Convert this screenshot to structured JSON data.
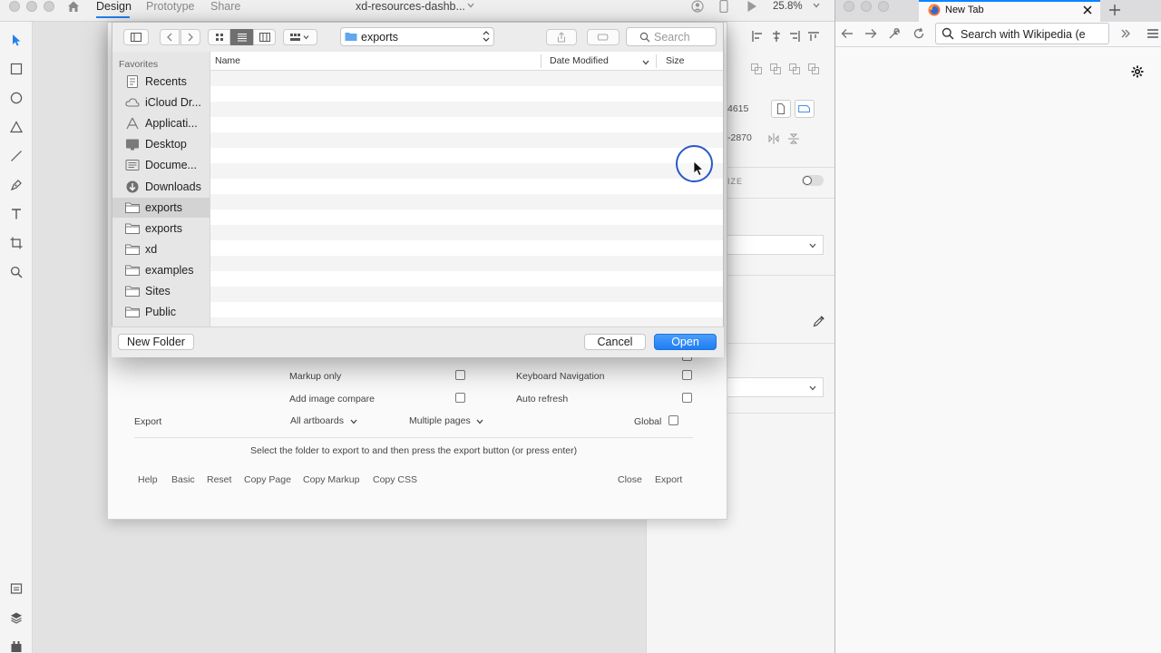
{
  "xd": {
    "tabs": {
      "design": "Design",
      "prototype": "Prototype",
      "share": "Share"
    },
    "document_title": "xd-resources-dashb...",
    "zoom_level": "25.8%",
    "props": {
      "x_value": "4615",
      "y_value": "-2870",
      "fragment": "IZE"
    }
  },
  "plugin": {
    "markup_only": "Markup only",
    "add_image_compare": "Add image compare",
    "keyboard_navigation": "Keyboard Navigation",
    "auto_refresh": "Auto refresh",
    "export_label": "Export",
    "all_artboards": "All artboards",
    "multiple_pages": "Multiple pages",
    "global": "Global",
    "hint": "Select the folder to export to and then press the export button (or press enter)",
    "links": {
      "help": "Help",
      "basic": "Basic",
      "reset": "Reset",
      "copy_page": "Copy Page",
      "copy_markup": "Copy Markup",
      "copy_css": "Copy CSS",
      "close": "Close",
      "export": "Export"
    }
  },
  "dialog": {
    "location": "exports",
    "search_placeholder": "Search",
    "sidebar": {
      "heading": "Favorites",
      "items": [
        {
          "label": "Recents",
          "icon": "recents-icon"
        },
        {
          "label": "iCloud Dr...",
          "icon": "cloud-icon"
        },
        {
          "label": "Applicati...",
          "icon": "applications-icon"
        },
        {
          "label": "Desktop",
          "icon": "desktop-icon"
        },
        {
          "label": "Docume...",
          "icon": "documents-icon"
        },
        {
          "label": "Downloads",
          "icon": "downloads-icon"
        },
        {
          "label": "exports",
          "icon": "folder-icon"
        },
        {
          "label": "exports",
          "icon": "folder-icon"
        },
        {
          "label": "xd",
          "icon": "folder-icon"
        },
        {
          "label": "examples",
          "icon": "folder-icon"
        },
        {
          "label": "Sites",
          "icon": "folder-icon"
        },
        {
          "label": "Public",
          "icon": "folder-icon"
        }
      ],
      "selected_index": 6
    },
    "columns": {
      "name": "Name",
      "date_modified": "Date Modified",
      "size": "Size"
    },
    "buttons": {
      "new_folder": "New Folder",
      "cancel": "Cancel",
      "open": "Open"
    }
  },
  "firefox": {
    "tab_title": "New Tab",
    "url_placeholder": "Search with Wikipedia (e"
  },
  "colors": {
    "accent": "#2680eb",
    "open_button": "#1f7ef3",
    "firefox_tab_accent": "#0a84ff"
  }
}
